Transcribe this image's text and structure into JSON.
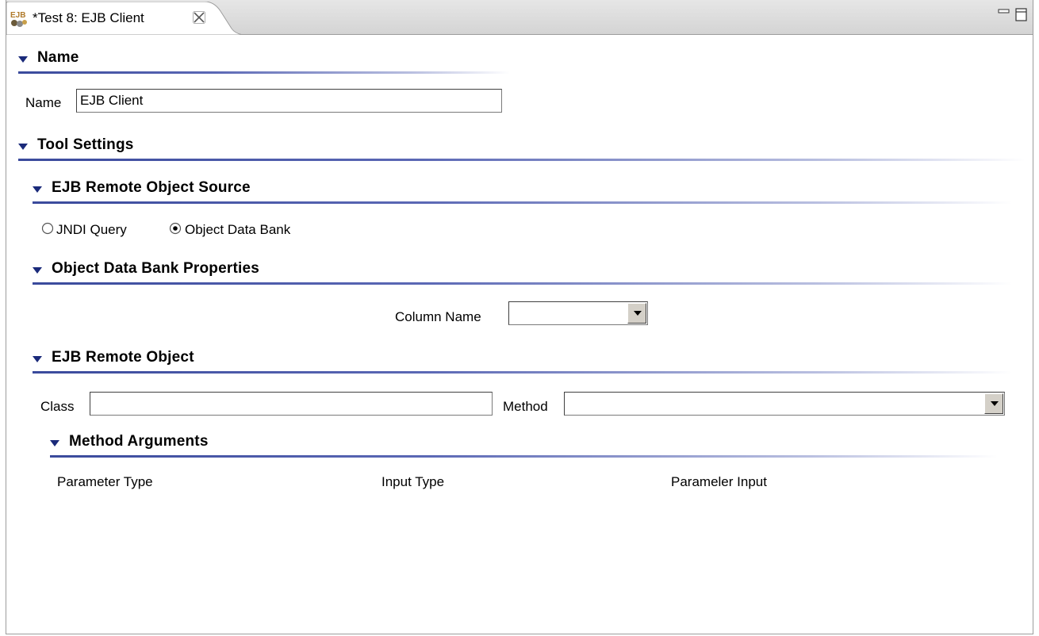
{
  "tab": {
    "title": "*Test 8: EJB Client",
    "icon": "ejb-icon",
    "close_icon": "close-icon"
  },
  "window_controls": {
    "minimize": "minimize-icon",
    "maximize": "maximize-icon"
  },
  "sections": {
    "name": {
      "title": "Name"
    },
    "tool_settings": {
      "title": "Tool Settings"
    },
    "remote_object_source": {
      "title": "EJB Remote Object Source"
    },
    "data_bank_properties": {
      "title": "Object Data Bank Properties"
    },
    "remote_object": {
      "title": "EJB Remote Object"
    },
    "method_arguments": {
      "title": "Method Arguments"
    }
  },
  "name_field": {
    "label": "Name",
    "value": "EJB Client"
  },
  "source_options": {
    "jndi": {
      "label": "JNDI Query",
      "selected": false
    },
    "data_bank": {
      "label": "Object Data Bank",
      "selected": true
    }
  },
  "column_name": {
    "label": "Column Name",
    "value": ""
  },
  "class_field": {
    "label": "Class",
    "value": ""
  },
  "method_field": {
    "label": "Method",
    "value": ""
  },
  "arguments_table": {
    "columns": [
      "Parameter Type",
      "Input Type",
      "Parameler Input"
    ]
  },
  "colors": {
    "section_line": "#3a4a9c",
    "tabbar_bg": "#d4d4d4"
  }
}
